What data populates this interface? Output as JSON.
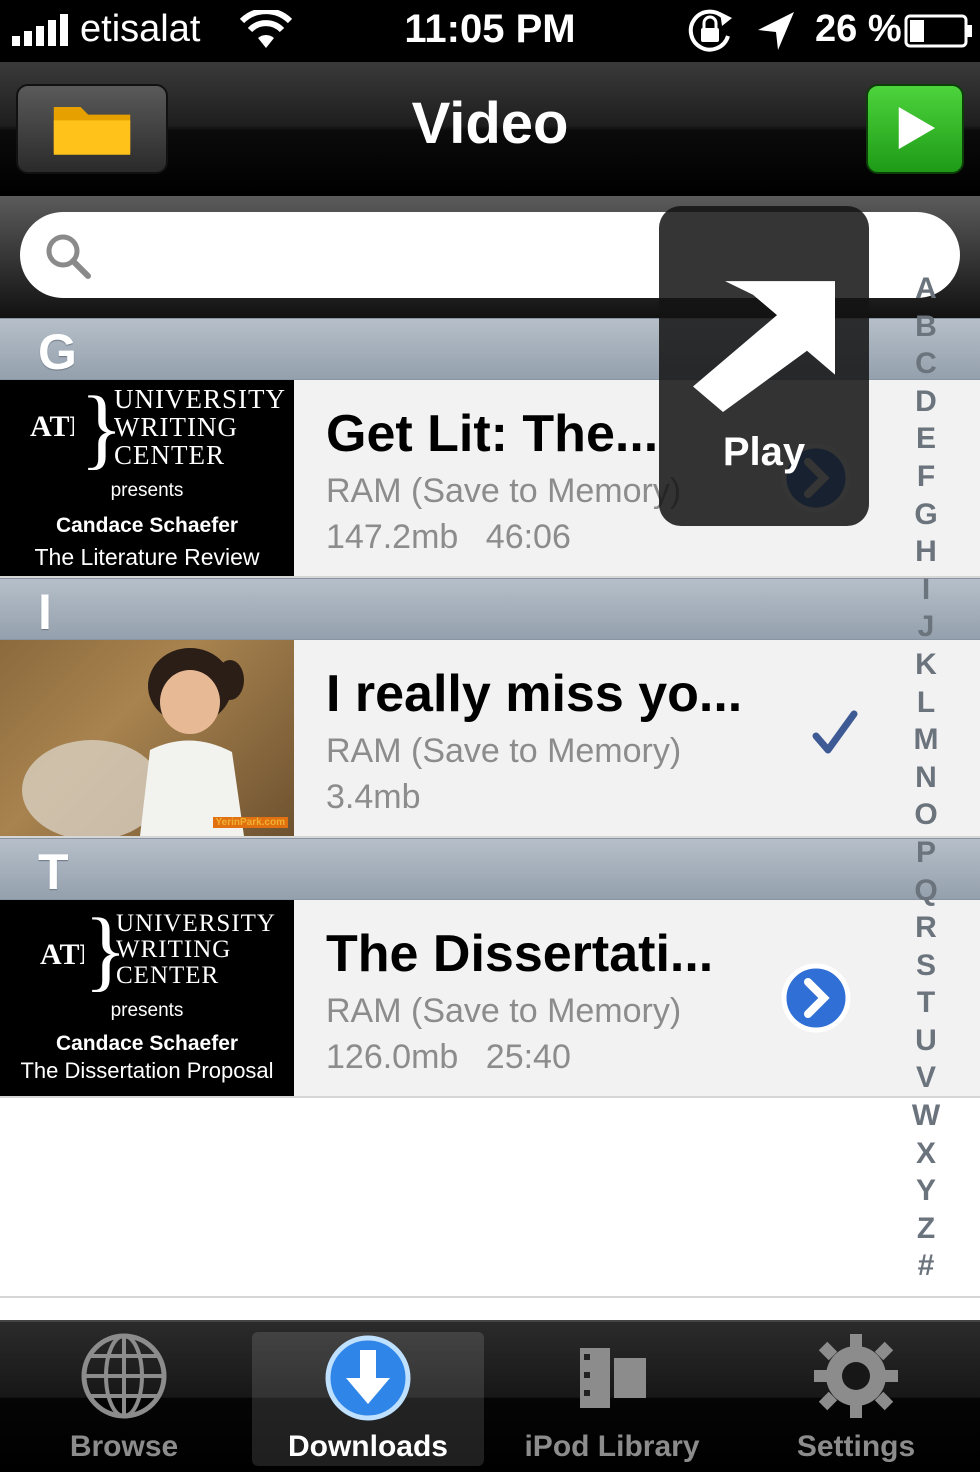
{
  "status_bar": {
    "carrier": "etisalat",
    "time": "11:05 PM",
    "battery_percent": "26 %"
  },
  "nav": {
    "title": "Video",
    "left_icon": "folder-icon",
    "right_icon": "play-icon"
  },
  "search": {
    "placeholder": "",
    "value": ""
  },
  "sections": [
    {
      "header": "G",
      "item": {
        "title": "Get Lit: The...",
        "storage": "RAM (Save to Memory)",
        "size": "147.2mb",
        "duration": "46:06",
        "thumb": {
          "line1": "UNIVERSITY",
          "line2": "WRITING",
          "line3": "CENTER",
          "presents": "presents",
          "presenter": "Candace Schaefer",
          "subtitle": "The Literature Review"
        }
      }
    },
    {
      "header": "I",
      "item": {
        "title": "I really miss yo...",
        "storage": "RAM (Save to Memory)",
        "size": "3.4mb",
        "watermark": "YerinPark.com"
      }
    },
    {
      "header": "T",
      "item": {
        "title": "The Dissertati...",
        "storage": "RAM (Save to Memory)",
        "size": "126.0mb",
        "duration": "25:40",
        "thumb": {
          "line1": "UNIVERSITY",
          "line2": "WRITING",
          "line3": "CENTER",
          "presents": "presents",
          "presenter": "Candace Schaefer",
          "subtitle": "The Dissertation Proposal"
        }
      }
    }
  ],
  "index_letters": [
    "A",
    "B",
    "C",
    "D",
    "E",
    "F",
    "G",
    "H",
    "I",
    "J",
    "K",
    "L",
    "M",
    "N",
    "O",
    "P",
    "Q",
    "R",
    "S",
    "T",
    "U",
    "V",
    "W",
    "X",
    "Y",
    "Z",
    "#"
  ],
  "play_tooltip": {
    "label": "Play"
  },
  "tabs": [
    {
      "label": "Browse",
      "icon": "globe-icon",
      "selected": false
    },
    {
      "label": "Downloads",
      "icon": "download-icon",
      "selected": true
    },
    {
      "label": "iPod Library",
      "icon": "film-icon",
      "selected": false
    },
    {
      "label": "Settings",
      "icon": "gear-icon",
      "selected": false
    }
  ],
  "colors": {
    "accent_blue": "#2f6fd6",
    "play_green": "#2bb521",
    "section_header": "#a3aeba"
  }
}
